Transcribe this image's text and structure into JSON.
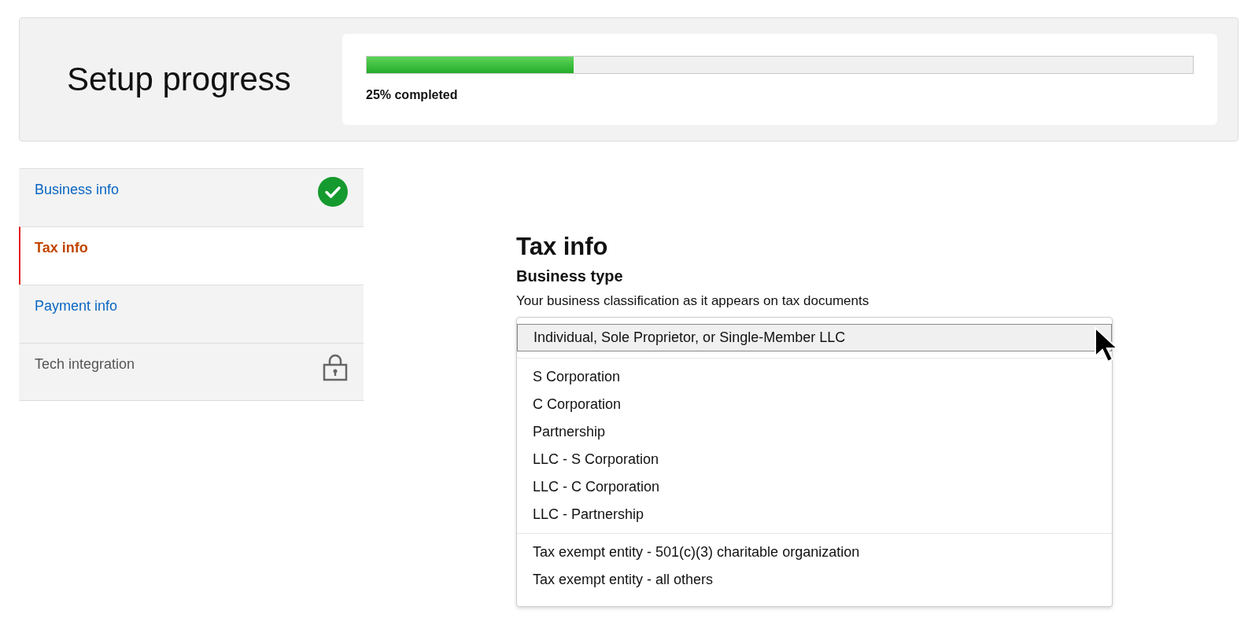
{
  "progress": {
    "title": "Setup progress",
    "level": 0.25,
    "label": "25% completed"
  },
  "steps": [
    {
      "label": "Business info",
      "kind": "done",
      "selected": false
    },
    {
      "label": "Tax info",
      "kind": "current",
      "selected": true
    },
    {
      "label": "Payment info",
      "kind": "todo",
      "selected": false
    },
    {
      "label": "Tech integration",
      "kind": "locked",
      "selected": false
    }
  ],
  "form": {
    "title": "Tax info",
    "field_label": "Business type",
    "hint": "Your business classification as it appears on tax documents",
    "option_groups": [
      [
        {
          "label": "Individual, Sole Proprietor, or Single-Member LLC",
          "selected": true
        }
      ],
      [
        {
          "label": "S Corporation",
          "selected": false
        },
        {
          "label": "C Corporation",
          "selected": false
        },
        {
          "label": "Partnership",
          "selected": false
        },
        {
          "label": "LLC - S Corporation",
          "selected": false
        },
        {
          "label": "LLC - C Corporation",
          "selected": false
        },
        {
          "label": "LLC - Partnership",
          "selected": false
        }
      ],
      [
        {
          "label": "Tax exempt entity - 501(c)(3) charitable organization",
          "selected": false
        },
        {
          "label": "Tax exempt entity - all others",
          "selected": false
        }
      ]
    ]
  }
}
